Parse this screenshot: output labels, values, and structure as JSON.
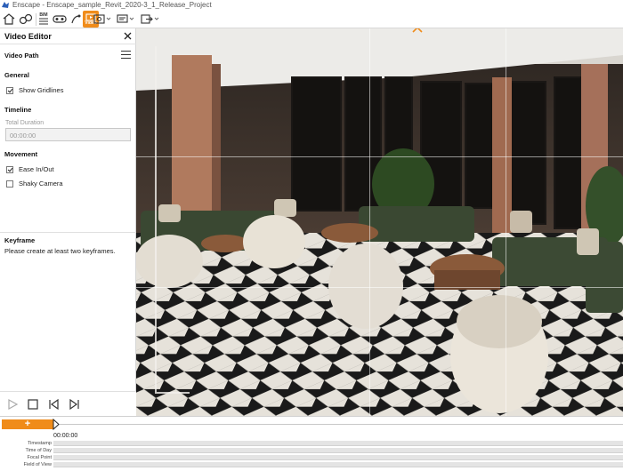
{
  "window": {
    "title": "Enscape - Enscape_sample_Revit_2020-3_1_Release_Project"
  },
  "toolbar": {
    "items": [
      {
        "name": "home-icon"
      },
      {
        "name": "views-icon"
      },
      {
        "name": "bim-icon",
        "label": "BIM"
      },
      {
        "name": "vr-headset-icon"
      },
      {
        "name": "camera-path-icon"
      },
      {
        "name": "video-editor-icon",
        "label": "Video",
        "active": true
      },
      {
        "name": "screenshot-icon"
      },
      {
        "name": "batch-render-icon"
      },
      {
        "name": "export-icon"
      }
    ],
    "accent": "#f08c1a"
  },
  "panel": {
    "title": "Video Editor",
    "video_path_label": "Video Path",
    "general": {
      "heading": "General",
      "show_gridlines": {
        "label": "Show Gridlines",
        "checked": true
      }
    },
    "timeline": {
      "heading": "Timeline",
      "total_duration_label": "Total Duration",
      "total_duration_value": "00:00:00"
    },
    "movement": {
      "heading": "Movement",
      "ease": {
        "label": "Ease In/Out",
        "checked": true
      },
      "shaky": {
        "label": "Shaky Camera",
        "checked": false
      }
    },
    "keyframe": {
      "heading": "Keyframe",
      "message": "Please create at least two keyframes."
    }
  },
  "timeline_bar": {
    "add_label": "+",
    "current_time": "00:00:00",
    "tracks": [
      "Timestamp",
      "Time of Day",
      "Focal Point",
      "Field of View"
    ]
  }
}
